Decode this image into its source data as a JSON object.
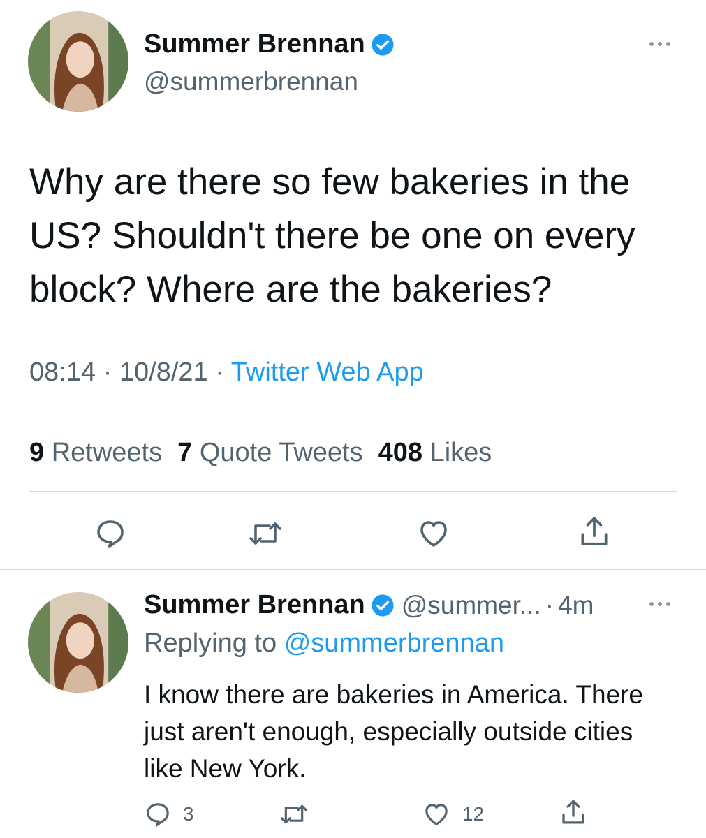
{
  "tweet": {
    "author_name": "Summer Brennan",
    "author_handle": "@summerbrennan",
    "text": "Why are there so few bakeries in the US? Shouldn't there be one on every block? Where are the bakeries?",
    "time": "08:14",
    "date": "10/8/21",
    "separator": "·",
    "source": "Twitter Web App",
    "stats": {
      "retweets_count": "9",
      "retweets_label": "Retweets",
      "quotes_count": "7",
      "quotes_label": "Quote Tweets",
      "likes_count": "408",
      "likes_label": "Likes"
    },
    "actions": [
      "reply-icon",
      "retweet-icon",
      "like-icon",
      "share-icon"
    ]
  },
  "reply": {
    "author_name": "Summer Brennan",
    "author_handle_truncated": "@summer...",
    "separator": "·",
    "age": "4m",
    "replying_to_label": "Replying to",
    "replying_to_handle": "@summerbrennan",
    "text": "I know there are bakeries in America. There just aren't enough, especially outside cities like New York.",
    "reply_count": "3",
    "like_count": "12"
  },
  "colors": {
    "accent": "#1d9bf0",
    "muted": "#536471",
    "text": "#0f1419",
    "divider": "#cfd9de"
  }
}
